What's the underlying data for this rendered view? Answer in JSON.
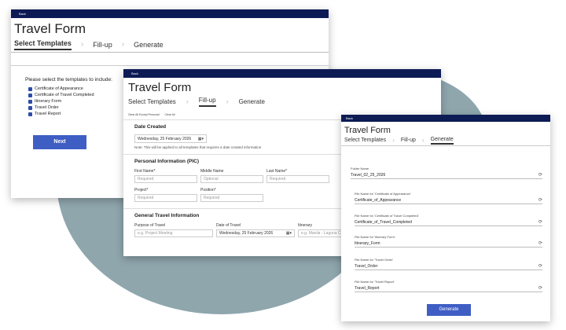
{
  "common": {
    "back": "Back",
    "title": "Travel Form",
    "steps": [
      "Select Templates",
      "Fill-up",
      "Generate"
    ]
  },
  "select": {
    "prompt": "Please select the templates to include:",
    "templates": [
      "Certificate of Appearance",
      "Certificate of Travel Completed",
      "Itinerary Form",
      "Travel Order",
      "Travel Report"
    ],
    "next": "Next"
  },
  "fillup": {
    "links": [
      "Clear All Except Personal",
      "Clear All"
    ],
    "date_section": "Date Created",
    "date_value": "Wednesday, 25  February  2026",
    "note": "Note: This will be applied to all templates that requires a date created information",
    "personal_section": "Personal Information (PIC)",
    "fields": {
      "first": {
        "label": "First Name*",
        "placeholder": "Required"
      },
      "middle": {
        "label": "Middle Name",
        "placeholder": "Optional"
      },
      "last": {
        "label": "Last Name*",
        "placeholder": "Required"
      },
      "project": {
        "label": "Project*",
        "placeholder": "Required"
      },
      "position": {
        "label": "Position*",
        "placeholder": "Required"
      }
    },
    "travel_section": "General Travel Information",
    "purpose": {
      "label": "Purpose of Travel",
      "placeholder": "e.g. Project Meeting"
    },
    "travel_date": {
      "label": "Date of Travel",
      "value": "Wednesday, 25  February  2026"
    },
    "itinerary": {
      "label": "Itinerary",
      "placeholder": "e.g. Manila - Laguna Ca"
    }
  },
  "generate": {
    "folder": {
      "label": "Folder Name",
      "value": "Travel_02_25_2026"
    },
    "files": [
      {
        "label": "File Name for 'Certificate of Appearance'",
        "value": "Certificate_of_Appearance"
      },
      {
        "label": "File Name for 'Certificate of Travel Completed'",
        "value": "Certificate_of_Travel_Completed"
      },
      {
        "label": "File Name for 'Itinerary Form'",
        "value": "Itinerary_Form"
      },
      {
        "label": "File Name for 'Travel Order'",
        "value": "Travel_Order"
      },
      {
        "label": "File Name for 'Travel Report'",
        "value": "Travel_Report"
      }
    ],
    "button": "Generate"
  }
}
